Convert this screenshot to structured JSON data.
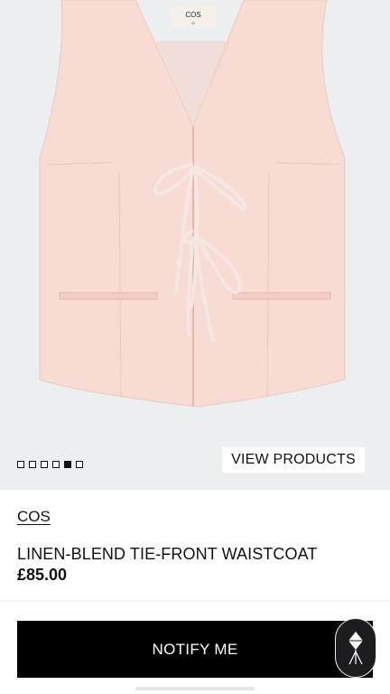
{
  "hero": {
    "garment_label_text": "COS",
    "dots_count": 6,
    "active_dot_index": 4,
    "view_products_label": "VIEW PRODUCTS",
    "background_color": "#eceff0",
    "garment_color": "#f8dcd4"
  },
  "product": {
    "brand": "COS",
    "name": "LINEN-BLEND TIE-FRONT WAISTCOAT",
    "price": "£85.00"
  },
  "actions": {
    "notify_label": "NOTIFY ME"
  },
  "icons": {
    "fab": "diamond-logo-icon"
  }
}
